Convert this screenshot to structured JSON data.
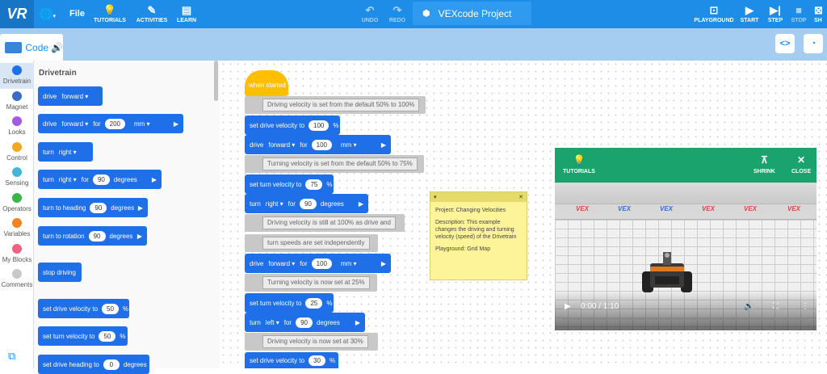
{
  "topbar": {
    "logo": "VR",
    "file": "File",
    "tutorials": "TUTORIALS",
    "activities": "ACTIVITIES",
    "learn": "LEARN",
    "undo": "UNDO",
    "redo": "REDO",
    "project_name": "VEXcode Project",
    "playground": "PLAYGROUND",
    "start": "START",
    "step": "STEP",
    "stop": "STOP",
    "shrink_cut": "SH"
  },
  "code_tab": "Code",
  "categories": [
    {
      "label": "Drivetrain",
      "color": "#1f6fe8"
    },
    {
      "label": "Magnet",
      "color": "#3a6cc6"
    },
    {
      "label": "Looks",
      "color": "#a25ae0"
    },
    {
      "label": "Control",
      "color": "#f5a623"
    },
    {
      "label": "Sensing",
      "color": "#45b5d8"
    },
    {
      "label": "Operators",
      "color": "#39b54a"
    },
    {
      "label": "Variables",
      "color": "#f58220"
    },
    {
      "label": "My Blocks",
      "color": "#f06080"
    },
    {
      "label": "Comments",
      "color": "#c8c8c8"
    }
  ],
  "palette": {
    "title": "Drivetrain",
    "blocks": {
      "b1": {
        "t1": "drive",
        "d1": "forward"
      },
      "b2": {
        "t1": "drive",
        "d1": "forward",
        "t2": "for",
        "v": "200",
        "d2": "mm"
      },
      "b3": {
        "t1": "turn",
        "d1": "right"
      },
      "b4": {
        "t1": "turn",
        "d1": "right",
        "t2": "for",
        "v": "90",
        "t3": "degrees"
      },
      "b5": {
        "t1": "turn to heading",
        "v": "90",
        "t3": "degrees"
      },
      "b6": {
        "t1": "turn to rotation",
        "v": "90",
        "t3": "degrees"
      },
      "b7": {
        "t1": "stop driving"
      },
      "b8": {
        "t1": "set drive velocity to",
        "v": "50",
        "t3": "%"
      },
      "b9": {
        "t1": "set turn velocity to",
        "v": "50",
        "t3": "%"
      },
      "b10": {
        "t1": "set drive heading to",
        "v": "0",
        "t3": "degrees"
      }
    }
  },
  "script": {
    "hat": "when started",
    "c1": "Driving velocity is set from the default 50% to 100%",
    "s1": {
      "t1": "set drive velocity to",
      "v": "100",
      "t3": "%"
    },
    "s2": {
      "t1": "drive",
      "d1": "forward",
      "t2": "for",
      "v": "100",
      "d2": "mm"
    },
    "c2": "Turning velocity is set from the default 50% to 75%",
    "s3": {
      "t1": "set turn velocity to",
      "v": "75",
      "t3": "%"
    },
    "s4": {
      "t1": "turn",
      "d1": "right",
      "t2": "for",
      "v": "90",
      "t3": "degrees"
    },
    "c3": "Driving velocity is still at 100% as drive and",
    "c4": "turn speeds are set independently",
    "s5": {
      "t1": "drive",
      "d1": "forward",
      "t2": "for",
      "v": "100",
      "d2": "mm"
    },
    "c5": "Turning velocity is now set at 25%",
    "s6": {
      "t1": "set turn velocity to",
      "v": "25",
      "t3": "%"
    },
    "s7": {
      "t1": "turn",
      "d1": "left",
      "t2": "for",
      "v": "90",
      "t3": "degrees"
    },
    "c6": "Driving velocity is now set at 30%",
    "s8": {
      "t1": "set drive velocity to",
      "v": "30",
      "t3": "%"
    }
  },
  "note": {
    "line1": "Project: Changing Velocities",
    "line2": "Description: This example changes the driving and turning velocity (speed) of the Drivetrain",
    "line3": "Playground:  Grid Map"
  },
  "playground": {
    "tutorials": "TUTORIALS",
    "shrink": "SHRINK",
    "close": "CLOSE",
    "time": "0:00 / 1:10",
    "wall_logo": "VEX",
    "progress": 0
  }
}
